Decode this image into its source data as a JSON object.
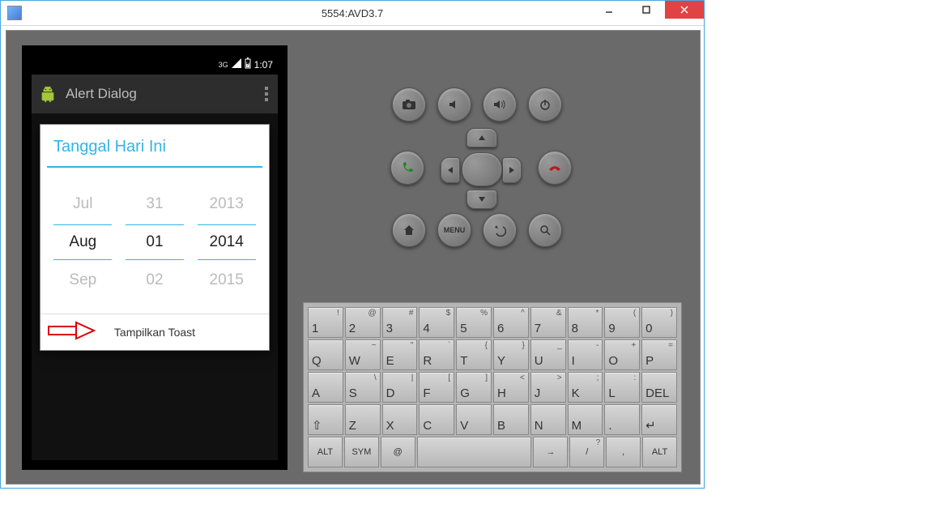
{
  "window": {
    "title": "5554:AVD3.7"
  },
  "status": {
    "network": "3G",
    "time": "1:07"
  },
  "app": {
    "title": "Alert Dialog"
  },
  "dialog": {
    "title": "Tanggal Hari Ini",
    "button": "Tampilkan Toast",
    "month_prev": "Jul",
    "month_cur": "Aug",
    "month_next": "Sep",
    "day_prev": "31",
    "day_cur": "01",
    "day_next": "02",
    "year_prev": "2013",
    "year_cur": "2014",
    "year_next": "2015"
  },
  "controls": {
    "menu": "MENU"
  },
  "keyboard": {
    "row1": [
      {
        "m": "1",
        "s": "!"
      },
      {
        "m": "2",
        "s": "@"
      },
      {
        "m": "3",
        "s": "#"
      },
      {
        "m": "4",
        "s": "$"
      },
      {
        "m": "5",
        "s": "%"
      },
      {
        "m": "6",
        "s": "^"
      },
      {
        "m": "7",
        "s": "&"
      },
      {
        "m": "8",
        "s": "*"
      },
      {
        "m": "9",
        "s": "("
      },
      {
        "m": "0",
        "s": ")"
      }
    ],
    "row2": [
      {
        "m": "Q",
        "s": ""
      },
      {
        "m": "W",
        "s": "~"
      },
      {
        "m": "E",
        "s": "\""
      },
      {
        "m": "R",
        "s": "`"
      },
      {
        "m": "T",
        "s": "{"
      },
      {
        "m": "Y",
        "s": "}"
      },
      {
        "m": "U",
        "s": "_"
      },
      {
        "m": "I",
        "s": "-"
      },
      {
        "m": "O",
        "s": "+"
      },
      {
        "m": "P",
        "s": "="
      }
    ],
    "row3": [
      {
        "m": "A",
        "s": ""
      },
      {
        "m": "S",
        "s": "\\"
      },
      {
        "m": "D",
        "s": "|"
      },
      {
        "m": "F",
        "s": "["
      },
      {
        "m": "G",
        "s": "]"
      },
      {
        "m": "H",
        "s": "<"
      },
      {
        "m": "J",
        "s": ">"
      },
      {
        "m": "K",
        "s": ";"
      },
      {
        "m": "L",
        "s": ":"
      },
      {
        "m": "DEL",
        "s": ""
      }
    ],
    "row4": [
      {
        "m": "⇧",
        "s": ""
      },
      {
        "m": "Z",
        "s": ""
      },
      {
        "m": "X",
        "s": ""
      },
      {
        "m": "C",
        "s": ""
      },
      {
        "m": "V",
        "s": ""
      },
      {
        "m": "B",
        "s": ""
      },
      {
        "m": "N",
        "s": ""
      },
      {
        "m": "M",
        "s": ""
      },
      {
        "m": ".",
        "s": ""
      },
      {
        "m": "↵",
        "s": ""
      }
    ],
    "row5": [
      {
        "m": "ALT",
        "s": ""
      },
      {
        "m": "SYM",
        "s": ""
      },
      {
        "m": "@",
        "s": ""
      },
      {
        "m": "",
        "s": ""
      },
      {
        "m": "→",
        "s": ""
      },
      {
        "m": "/",
        "s": "?"
      },
      {
        "m": ",",
        "s": ""
      },
      {
        "m": "ALT",
        "s": ""
      }
    ]
  }
}
